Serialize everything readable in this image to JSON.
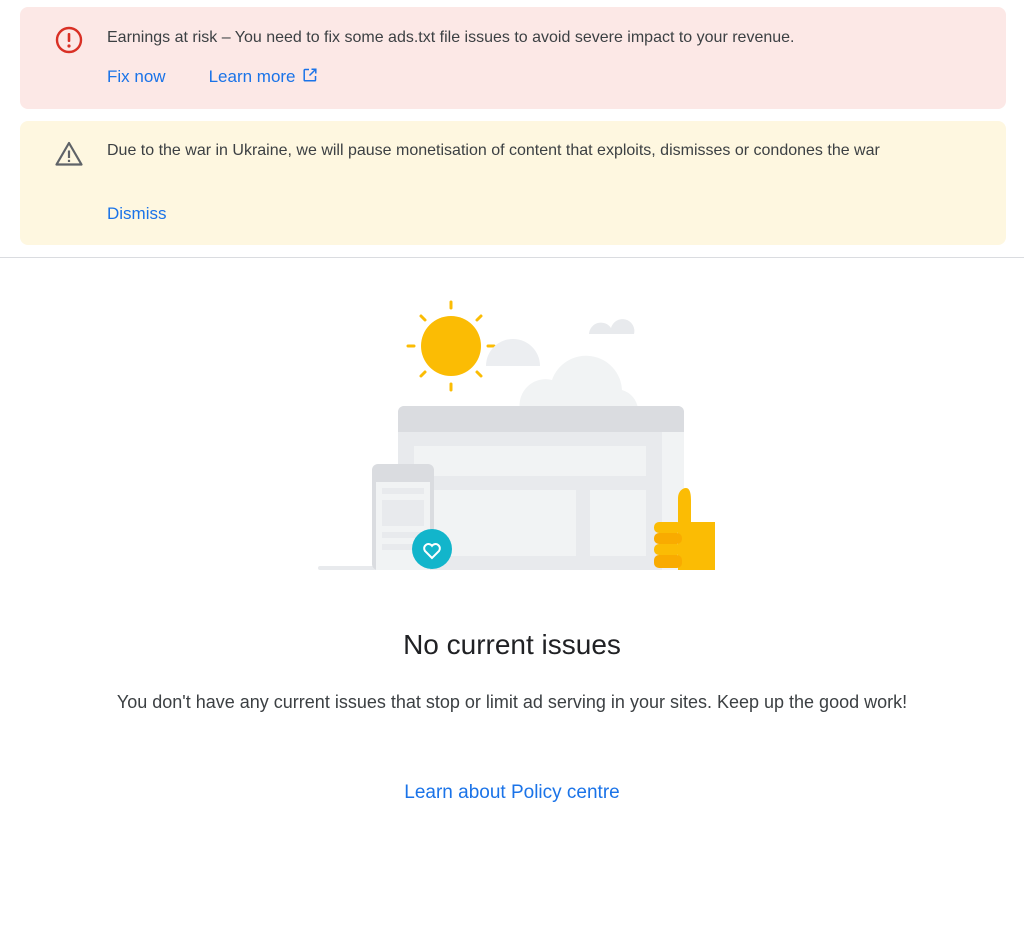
{
  "alerts": {
    "error": {
      "icon": "error-circle-icon",
      "message": "Earnings at risk – You need to fix some ads.txt file issues to avoid severe impact to your revenue.",
      "actions": {
        "fix_now": "Fix now",
        "learn_more": "Learn more",
        "learn_more_icon": "open-in-new-icon"
      },
      "color": "#fce8e6",
      "icon_color": "#d93025"
    },
    "warning": {
      "icon": "warning-triangle-icon",
      "message": "Due to the war in Ukraine, we will pause monetisation of content that exploits, dismisses or condones the war",
      "actions": {
        "dismiss": "Dismiss"
      },
      "color": "#fef7e0",
      "icon_color": "#5f6368"
    }
  },
  "empty_state": {
    "illustration_icon": "no-issues-illustration",
    "title": "No current issues",
    "description": "You don't have any current issues that stop or limit ad serving in your sites. Keep up the good work!",
    "link": "Learn about Policy centre"
  },
  "colors": {
    "link": "#1a73e8",
    "sun": "#fbbc04",
    "teal": "#12b5cb"
  }
}
